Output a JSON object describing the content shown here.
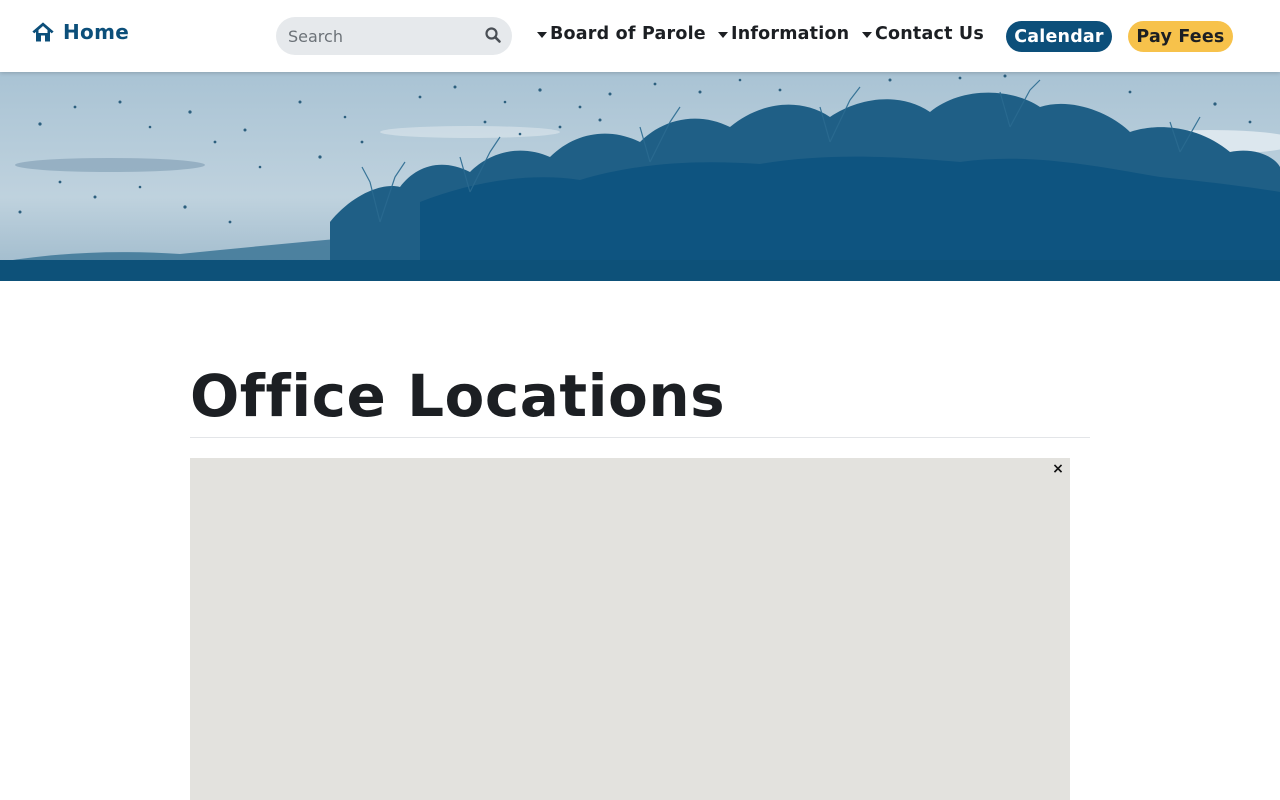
{
  "header": {
    "home_label": "Home",
    "search": {
      "placeholder": "Search",
      "value": ""
    },
    "nav": [
      {
        "label": "Board of Parole"
      },
      {
        "label": "Information"
      },
      {
        "label": "Contact Us"
      }
    ],
    "calendar_label": "Calendar",
    "pay_fees_label": "Pay Fees"
  },
  "main": {
    "title": "Office Locations",
    "map": {
      "close_label": "×"
    }
  },
  "colors": {
    "brand_blue": "#0c4f7a",
    "accent_yellow": "#f7c24b",
    "map_background": "#e3e2de"
  },
  "icons": [
    "home-icon",
    "search-icon",
    "caret-down-icon",
    "close-icon"
  ]
}
